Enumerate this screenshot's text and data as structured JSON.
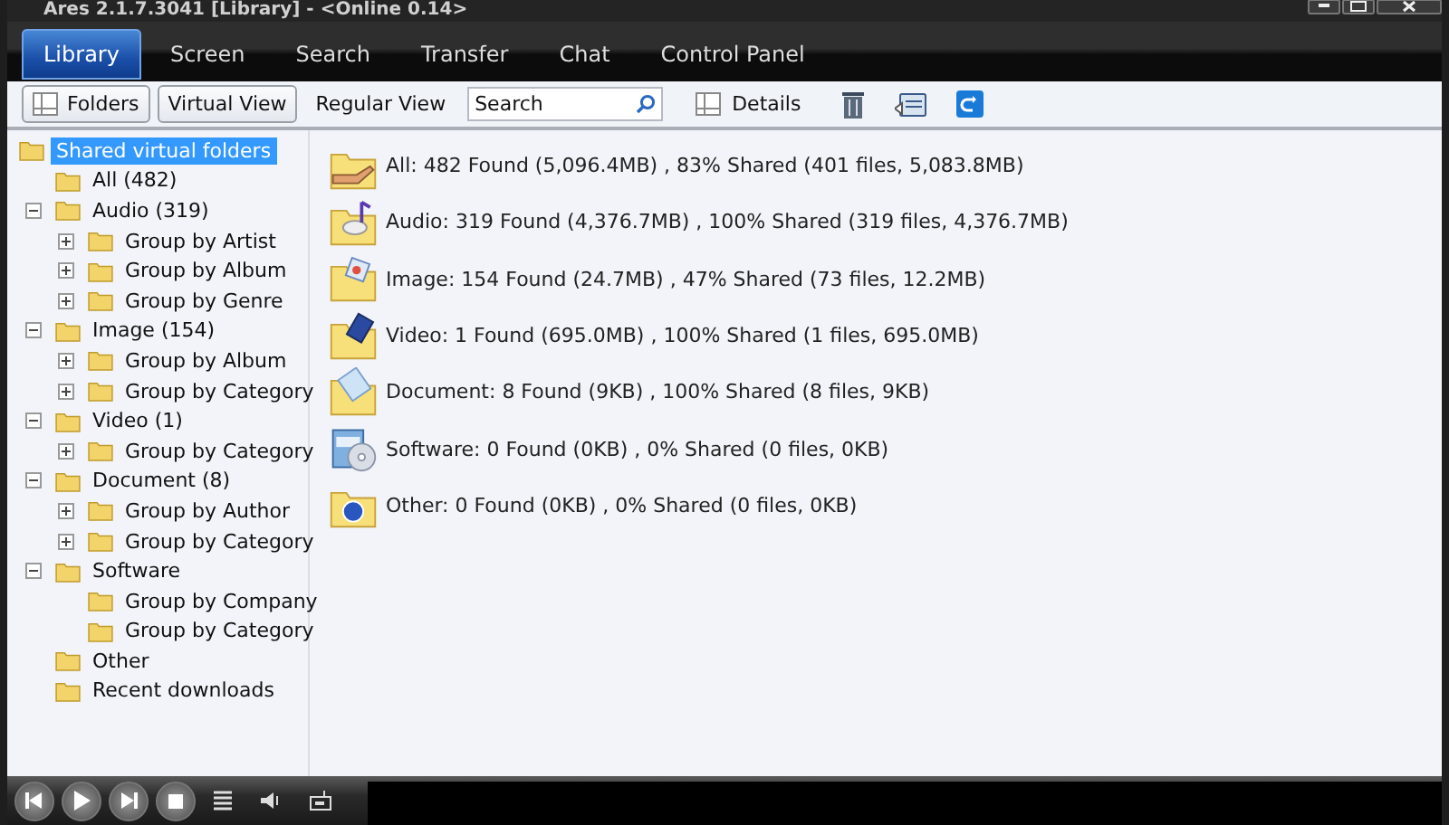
{
  "window": {
    "title": "Ares 2.1.7.3041  [Library]  -  <Online 0.14>"
  },
  "tabs": [
    {
      "label": "Library",
      "selected": true
    },
    {
      "label": "Screen",
      "selected": false
    },
    {
      "label": "Search",
      "selected": false
    },
    {
      "label": "Transfer",
      "selected": false
    },
    {
      "label": "Chat",
      "selected": false
    },
    {
      "label": "Control Panel",
      "selected": false
    }
  ],
  "toolbar": {
    "folders": "Folders",
    "virtual_view": "Virtual View",
    "regular_view": "Regular View",
    "search": {
      "value": "Search"
    },
    "details": "Details"
  },
  "tree": [
    {
      "label": "Shared virtual folders",
      "selected": true,
      "children": [
        {
          "label": "All (482)",
          "selected": false
        },
        {
          "label": "Audio (319)",
          "selected": false,
          "expanded": true,
          "children": [
            {
              "label": "Group by Artist",
              "selected": false,
              "expanded": false
            },
            {
              "label": "Group by Album",
              "selected": false,
              "expanded": false
            },
            {
              "label": "Group by Genre",
              "selected": false,
              "expanded": false
            }
          ]
        },
        {
          "label": "Image (154)",
          "selected": false,
          "expanded": true,
          "children": [
            {
              "label": "Group by Album",
              "selected": false,
              "expanded": false
            },
            {
              "label": "Group by Category",
              "selected": false,
              "expanded": false
            }
          ]
        },
        {
          "label": "Video (1)",
          "selected": false,
          "expanded": true,
          "children": [
            {
              "label": "Group by Category",
              "selected": false,
              "expanded": false
            }
          ]
        },
        {
          "label": "Document (8)",
          "selected": false,
          "expanded": true,
          "children": [
            {
              "label": "Group by Author",
              "selected": false,
              "expanded": false
            },
            {
              "label": "Group by Category",
              "selected": false,
              "expanded": false
            }
          ]
        },
        {
          "label": "Software",
          "selected": false,
          "expanded": true,
          "children": [
            {
              "label": "Group by Company",
              "selected": false
            },
            {
              "label": "Group by Category",
              "selected": false
            }
          ]
        },
        {
          "label": "Other",
          "selected": false
        },
        {
          "label": "Recent downloads",
          "selected": false
        }
      ]
    }
  ],
  "summary": [
    {
      "kind": "all",
      "text": "All: 482 Found (5,096.4MB) , 83% Shared (401 files, 5,083.8MB)"
    },
    {
      "kind": "audio",
      "text": "Audio: 319 Found (4,376.7MB) , 100% Shared (319 files, 4,376.7MB)"
    },
    {
      "kind": "image",
      "text": "Image: 154 Found (24.7MB) , 47% Shared (73 files, 12.2MB)"
    },
    {
      "kind": "video",
      "text": "Video: 1 Found (695.0MB) , 100% Shared (1 files, 695.0MB)"
    },
    {
      "kind": "document",
      "text": "Document: 8 Found (9KB) , 100% Shared (8 files, 9KB)"
    },
    {
      "kind": "software",
      "text": "Software: 0 Found (0KB) , 0% Shared (0 files, 0KB)"
    },
    {
      "kind": "other",
      "text": "Other: 0 Found (0KB) , 0% Shared (0 files, 0KB)"
    }
  ]
}
